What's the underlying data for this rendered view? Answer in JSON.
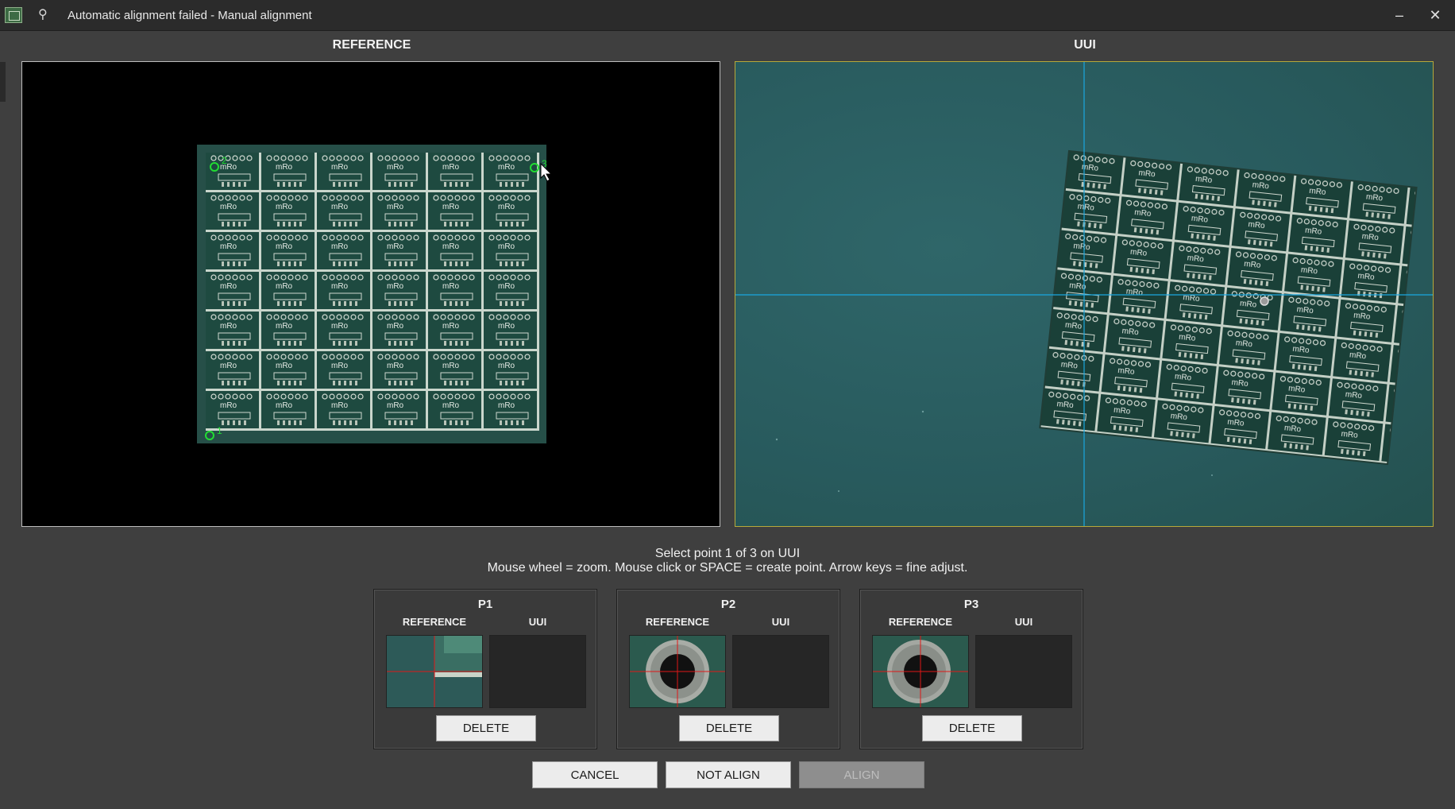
{
  "window": {
    "title": "Automatic alignment failed - Manual alignment",
    "minimize": "–",
    "close": "✕"
  },
  "reference_panel": {
    "label": "REFERENCE",
    "marker_labels": [
      "1",
      "2",
      "3"
    ]
  },
  "uui_panel": {
    "label": "UUI"
  },
  "instructions": {
    "line1": "Select point 1 of 3 on UUI",
    "line2": "Mouse wheel = zoom. Mouse click or SPACE = create point. Arrow keys = fine adjust."
  },
  "pcb": {
    "cols": 6,
    "rows": 7,
    "logo_text": "mRo"
  },
  "points": [
    {
      "title": "P1",
      "ref_label": "REFERENCE",
      "uui_label": "UUI",
      "delete_label": "DELETE",
      "ref_thumb": "board-corner"
    },
    {
      "title": "P2",
      "ref_label": "REFERENCE",
      "uui_label": "UUI",
      "delete_label": "DELETE",
      "ref_thumb": "pad-hole"
    },
    {
      "title": "P3",
      "ref_label": "REFERENCE",
      "uui_label": "UUI",
      "delete_label": "DELETE",
      "ref_thumb": "pad-hole"
    }
  ],
  "buttons": {
    "cancel": "CANCEL",
    "not_align": "NOT ALIGN",
    "align": "ALIGN"
  },
  "colors": {
    "marker": "#22dd33",
    "crosshair": "#1aa7e0",
    "thumb_cross": "#e01818",
    "uui_bg": "#2b5e62"
  }
}
